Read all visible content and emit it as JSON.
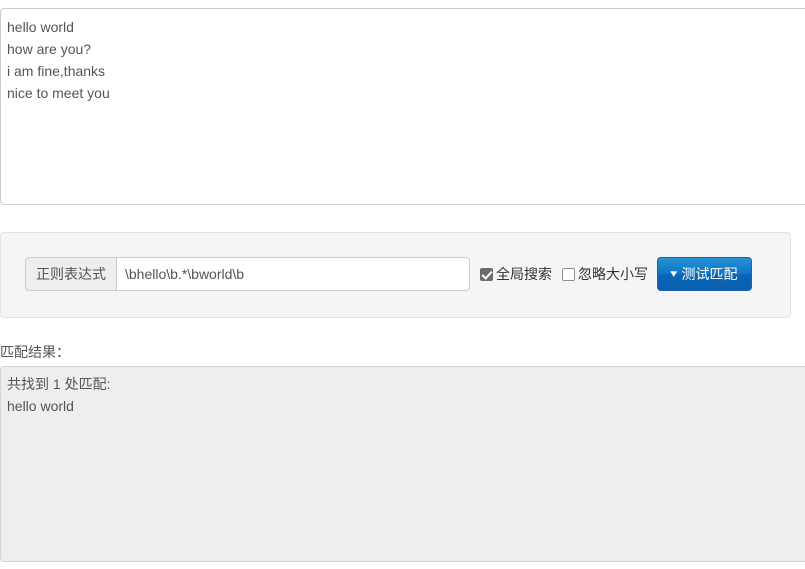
{
  "sample_text": {
    "value": "hello world\nhow are you?\ni am fine,thanks\nnice to meet you",
    "placeholder": ""
  },
  "options_panel": {
    "regex_group": {
      "addon_label": "正则表达式",
      "input_value": "\\bhello\\b.*\\bworld\\b",
      "input_placeholder": ""
    },
    "checkboxes": [
      {
        "label": "全局搜索",
        "checked": true
      },
      {
        "label": "忽略大小写",
        "checked": false
      }
    ],
    "test_button": {
      "label": "测试匹配",
      "icon": "chevron-down-icon",
      "color": "#1074c4"
    }
  },
  "result": {
    "label": "匹配结果：",
    "summary": "共找到 1 处匹配:",
    "matches": [
      "hello world"
    ],
    "text": "共找到 1 处匹配:\nhello world"
  }
}
